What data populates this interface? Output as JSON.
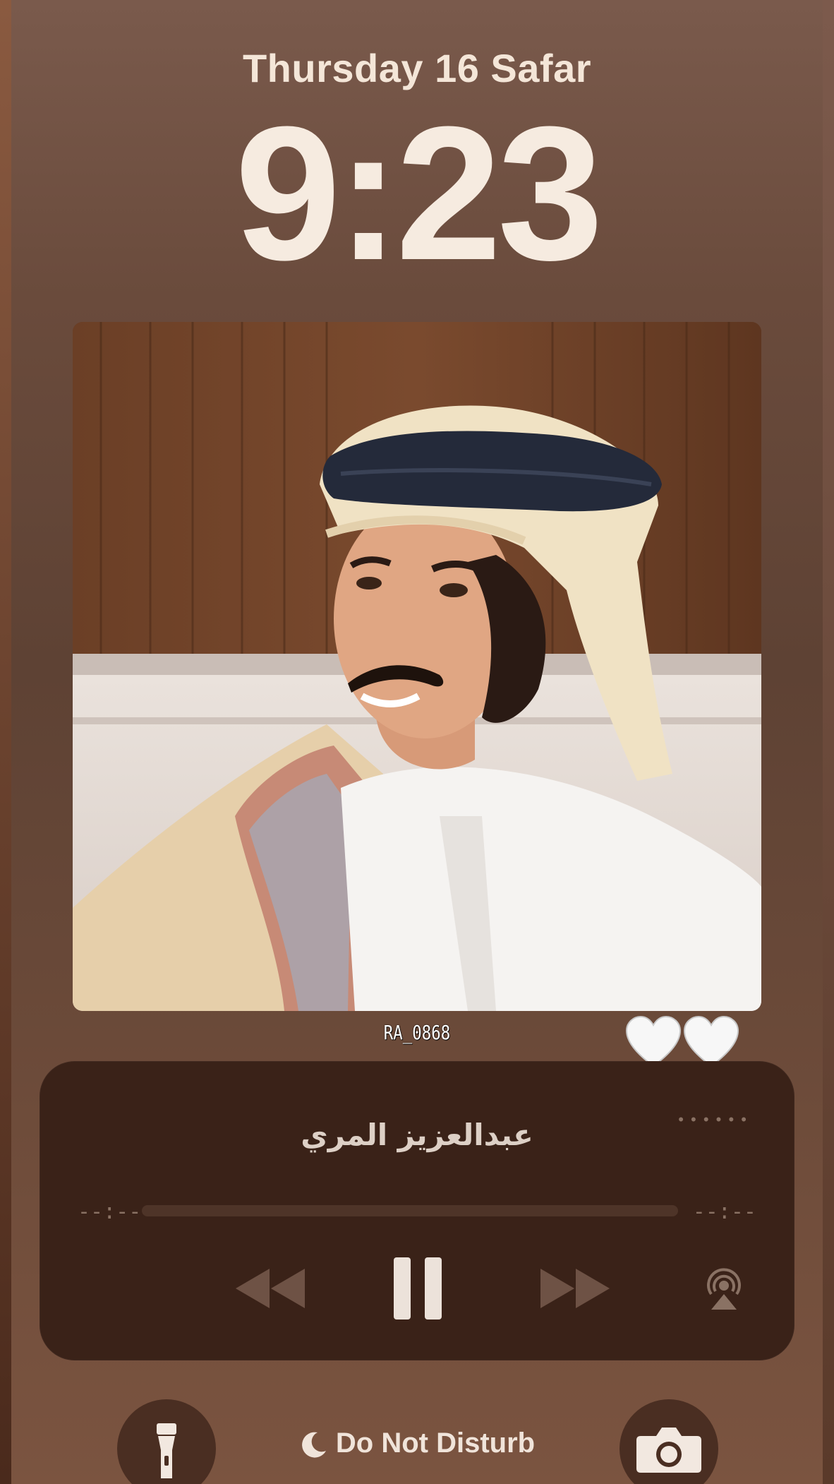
{
  "lock_screen": {
    "date": "Thursday 16 Safar",
    "time": "9:23"
  },
  "album_art": {
    "watermark": "RA_0868",
    "hearts": [
      "white-heart-icon",
      "white-heart-icon"
    ]
  },
  "now_playing": {
    "title": "عبدالعزيز المري",
    "elapsed": "--:--",
    "remaining": "--:--",
    "progress": 0,
    "controls": [
      "rewind-icon",
      "pause-icon",
      "fast-forward-icon",
      "airplay-icon"
    ]
  },
  "bottom_bar": {
    "left_button_icon": "flashlight-icon",
    "focus_label": "Do Not Disturb",
    "focus_icon": "moon-icon",
    "right_button_icon": "camera-icon"
  },
  "colors": {
    "player_bg": "#3a2218",
    "text_light": "#f6ebe0",
    "muted": "#8a7264"
  }
}
